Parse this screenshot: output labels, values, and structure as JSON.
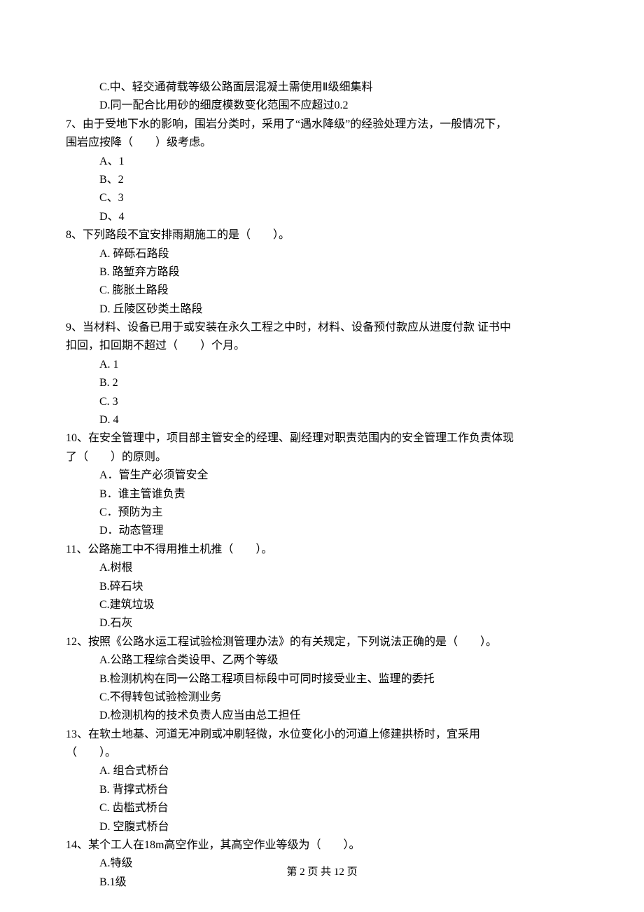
{
  "q6": {
    "optC": "C.中、轻交通荷载等级公路面层混凝土需使用Ⅱ级细集料",
    "optD": "D.同一配合比用砂的细度模数变化范围不应超过0.2"
  },
  "q7": {
    "stem1": "7、由于受地下水的影响，围岩分类时，采用了“遇水降级”的经验处理方法，一般情况下，",
    "stem2": "围岩应按降（　　）级考虑。",
    "a": "A、1",
    "b": "B、2",
    "c": "C、3",
    "d": "D、4"
  },
  "q8": {
    "stem": "8、下列路段不宜安排雨期施工的是（　　）。",
    "a": "A. 碎砾石路段",
    "b": "B. 路堑弃方路段",
    "c": "C. 膨胀土路段",
    "d": "D. 丘陵区砂类土路段"
  },
  "q9": {
    "stem1": "9、当材料、设备已用于或安装在永久工程之中时，材料、设备预付款应从进度付款 证书中",
    "stem2": "扣回，扣回期不超过（　　）个月。",
    "a": "A. 1",
    "b": "B. 2",
    "c": "C. 3",
    "d": "D. 4"
  },
  "q10": {
    "stem1": "10、在安全管理中，项目部主管安全的经理、副经理对职责范围内的安全管理工作负责体现",
    "stem2": "了（　　）的原则。",
    "a": "A．管生产必须管安全",
    "b": "B．谁主管谁负责",
    "c": "C．预防为主",
    "d": "D．动态管理"
  },
  "q11": {
    "stem": "11、公路施工中不得用推土机推（　　）。",
    "a": "A.树根",
    "b": "B.碎石块",
    "c": "C.建筑垃圾",
    "d": "D.石灰"
  },
  "q12": {
    "stem": "12、按照《公路水运工程试验检测管理办法》的有关规定，下列说法正确的是（　　）。",
    "a": "A.公路工程综合类设甲、乙两个等级",
    "b": "B.检测机构在同一公路工程项目标段中可同时接受业主、监理的委托",
    "c": "C.不得转包试验检测业务",
    "d": "D.检测机构的技术负责人应当由总工担任"
  },
  "q13": {
    "stem1": "13、在软土地基、河道无冲刷或冲刷轻微，水位变化小的河道上修建拱桥时，宜采用",
    "stem2": "（　　）。",
    "a": "A. 组合式桥台",
    "b": "B. 背撑式桥台",
    "c": "C. 齿槛式桥台",
    "d": "D. 空腹式桥台"
  },
  "q14": {
    "stem": "14、某个工人在18m高空作业，其高空作业等级为（　　）。",
    "a": "A.特级",
    "b": "B.1级"
  },
  "footer": "第 2 页 共 12 页"
}
